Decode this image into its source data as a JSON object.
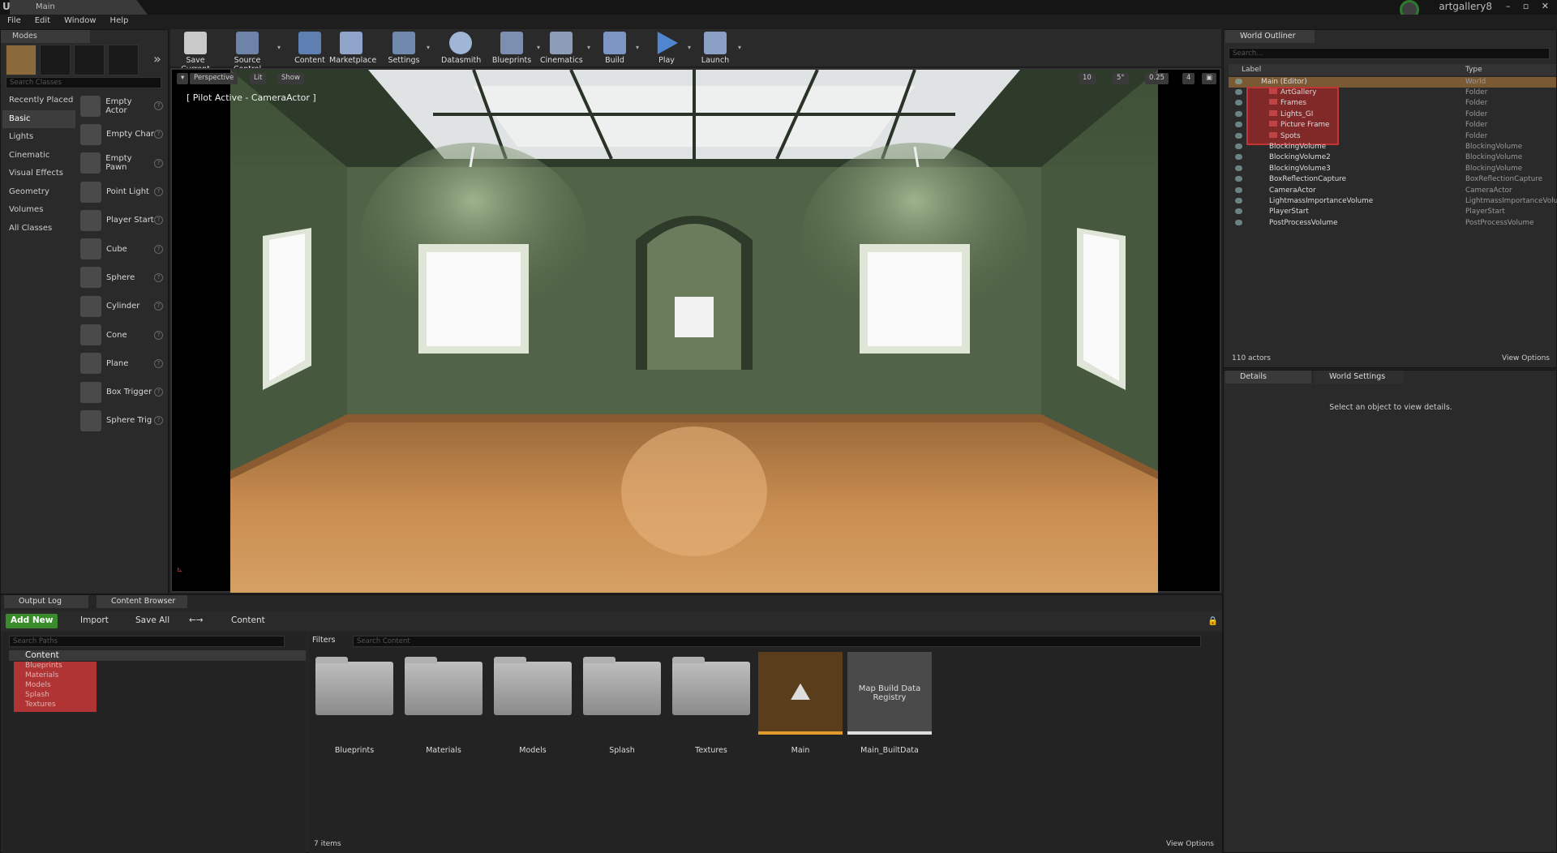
{
  "window": {
    "tab_title": "Main",
    "project": "artgallery8"
  },
  "menu": [
    "File",
    "Edit",
    "Window",
    "Help"
  ],
  "modes": {
    "tab": "Modes",
    "search_placeholder": "Search Classes",
    "categories": [
      "Recently Placed",
      "Basic",
      "Lights",
      "Cinematic",
      "Visual Effects",
      "Geometry",
      "Volumes",
      "All Classes"
    ],
    "items": [
      "Empty Actor",
      "Empty Char",
      "Empty Pawn",
      "Point Light",
      "Player Start",
      "Cube",
      "Sphere",
      "Cylinder",
      "Cone",
      "Plane",
      "Box Trigger",
      "Sphere Trig"
    ]
  },
  "toolbar": {
    "buttons": [
      "Save Current",
      "Source Control",
      "Content",
      "Marketplace",
      "Settings",
      "Datasmith",
      "Blueprints",
      "Cinematics",
      "Build",
      "Play",
      "Launch"
    ]
  },
  "viewport": {
    "perspective": "Perspective",
    "lit": "Lit",
    "show": "Show",
    "pilot_label": "[ Pilot Active - CameraActor ]",
    "grid_snap": "10",
    "rot_snap": "5°",
    "scale_snap": "0.25",
    "cam_speed": "4"
  },
  "outliner": {
    "tab": "World Outliner",
    "search_placeholder": "Search...",
    "col_label": "Label",
    "col_type": "Type",
    "rows": [
      {
        "label": "Main (Editor)",
        "type": "World"
      },
      {
        "label": "ArtGallery",
        "type": "Folder"
      },
      {
        "label": "Frames",
        "type": "Folder"
      },
      {
        "label": "Lights_GI",
        "type": "Folder"
      },
      {
        "label": "Picture Frame",
        "type": "Folder"
      },
      {
        "label": "Spots",
        "type": "Folder"
      },
      {
        "label": "BlockingVolume",
        "type": "BlockingVolume"
      },
      {
        "label": "BlockingVolume2",
        "type": "BlockingVolume"
      },
      {
        "label": "BlockingVolume3",
        "type": "BlockingVolume"
      },
      {
        "label": "BoxReflectionCapture",
        "type": "BoxReflectionCapture"
      },
      {
        "label": "CameraActor",
        "type": "CameraActor"
      },
      {
        "label": "LightmassImportanceVolume",
        "type": "LightmassImportanceVolum"
      },
      {
        "label": "PlayerStart",
        "type": "PlayerStart"
      },
      {
        "label": "PostProcessVolume",
        "type": "PostProcessVolume"
      }
    ],
    "actor_count": "110 actors",
    "view_options": "View Options"
  },
  "details": {
    "tab": "Details",
    "tab2": "World Settings",
    "message": "Select an object to view details."
  },
  "bottom": {
    "tab_output": "Output Log",
    "tab_content": "Content Browser",
    "add_new": "Add New",
    "import": "Import",
    "save_all": "Save All",
    "path": "Content",
    "path_search": "Search Paths",
    "tree_root": "Content",
    "tree_children": [
      "Blueprints",
      "Materials",
      "Models",
      "Splash",
      "Textures"
    ],
    "filters": "Filters",
    "content_search": "Search Content",
    "assets": [
      "Blueprints",
      "Materials",
      "Models",
      "Splash",
      "Textures",
      "Main",
      "Main_BuiltData"
    ],
    "map_registry": "Map Build Data Registry",
    "items_count": "7 items",
    "view_options": "View Options"
  }
}
